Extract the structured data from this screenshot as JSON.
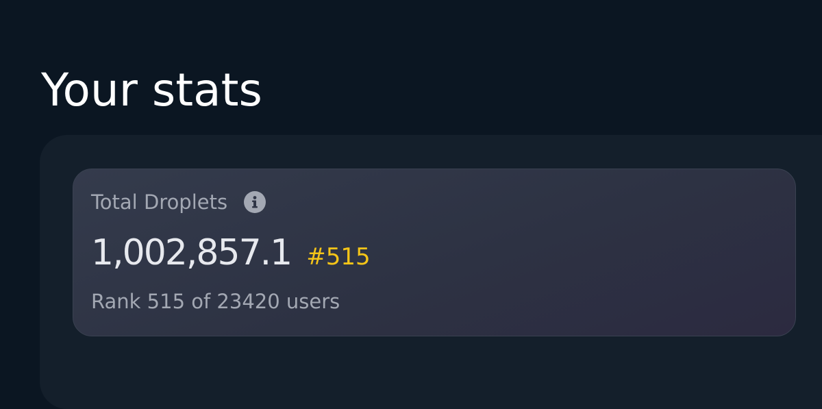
{
  "page": {
    "title": "Your stats"
  },
  "stat_card": {
    "label": "Total Droplets",
    "info_icon": "info-icon",
    "value": "1,002,857.1",
    "rank_badge": "#515",
    "rank_text": "Rank 515 of 23420 users"
  },
  "colors": {
    "background": "#0b1622",
    "panel": "#141f2b",
    "card": "#343b4c",
    "accent": "#f5c518",
    "muted_text": "#a3a8b3"
  }
}
